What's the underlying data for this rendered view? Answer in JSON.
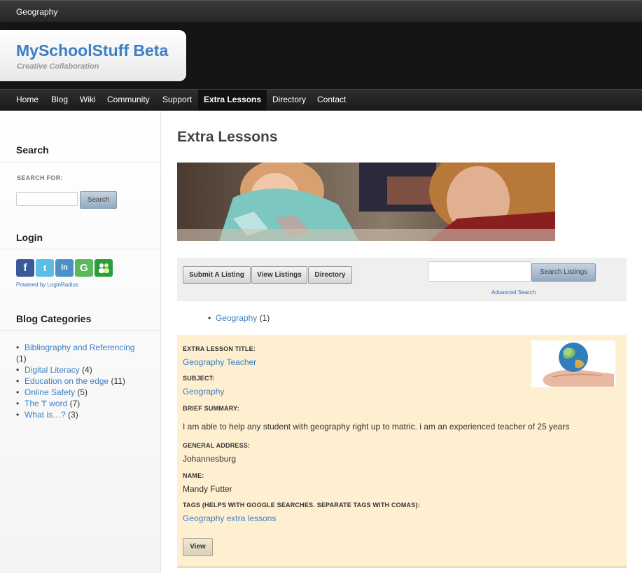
{
  "topbar": {
    "crumb": "Geography"
  },
  "site": {
    "title": "MySchoolStuff Beta",
    "tagline": "Creative Collaboration"
  },
  "nav": {
    "items": [
      "Home",
      "Blog",
      "Wiki",
      "Community",
      "Support",
      "Extra Lessons",
      "Directory",
      "Contact"
    ],
    "active": "Extra Lessons"
  },
  "sidebar": {
    "search": {
      "heading": "Search",
      "label": "SEARCH FOR:",
      "input_value": "",
      "button": "Search"
    },
    "login": {
      "heading": "Login",
      "providers": [
        "facebook-icon",
        "twitter-icon",
        "linkedin-icon",
        "google-icon",
        "messenger-icon"
      ],
      "powered": "Powered by LoginRadius"
    },
    "categories": {
      "heading": "Blog Categories",
      "items": [
        {
          "name": "Bibliography and Referencing",
          "count": "(1)"
        },
        {
          "name": "Digital Literacy",
          "count": "(4)"
        },
        {
          "name": "Education on the edge",
          "count": "(11)"
        },
        {
          "name": "Online Safety",
          "count": "(5)"
        },
        {
          "name": "The 'f' word",
          "count": "(7)"
        },
        {
          "name": "What is…?",
          "count": "(3)"
        }
      ]
    }
  },
  "main": {
    "title": "Extra Lessons",
    "toolbar": {
      "buttons": [
        "Submit A Listing",
        "View Listings",
        "Directory"
      ],
      "search_value": "",
      "search_button": "Search Listings",
      "advanced": "Advanced Search"
    },
    "subcategory": {
      "name": "Geography",
      "count": "(1)"
    },
    "listing": {
      "title_label": "EXTRA LESSON TITLE:",
      "title": "Geography Teacher",
      "subject_label": "SUBJECT:",
      "subject": "Geography",
      "summary_label": "BRIEF SUMMARY:",
      "summary": "I am able to help any student with geography right up to matric. i am an experienced teacher of 25 years",
      "address_label": "GENERAL ADDRESS:",
      "address": "Johannesburg",
      "name_label": "NAME:",
      "name": "Mandy Futter",
      "tags_label": "TAGS (HELPS WITH GOOGLE SEARCHES. SEPARATE TAGS WITH COMAS):",
      "tags": "Geography extra lessons",
      "view_button": "View"
    }
  },
  "colors": {
    "link": "#3b7fc4",
    "listing_bg": "#fdefd0",
    "header_bg": "#151515"
  }
}
